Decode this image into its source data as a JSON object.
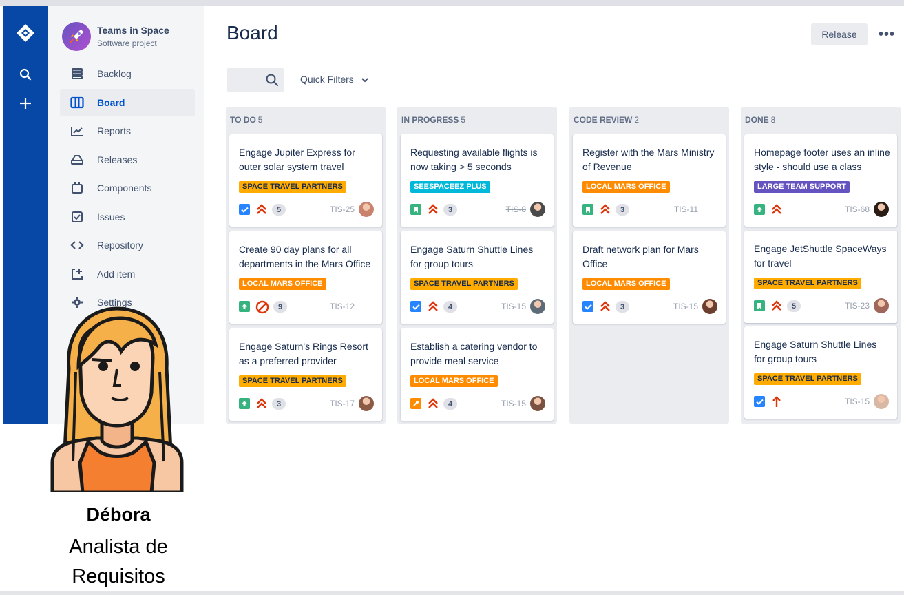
{
  "project": {
    "name": "Teams in Space",
    "type": "Software project"
  },
  "global_nav": {
    "icons": [
      "jira-logo-icon",
      "search-icon",
      "plus-icon"
    ]
  },
  "sidebar": {
    "items": [
      {
        "label": "Backlog",
        "icon": "backlog-icon",
        "active": false
      },
      {
        "label": "Board",
        "icon": "board-icon",
        "active": true
      },
      {
        "label": "Reports",
        "icon": "reports-icon",
        "active": false
      },
      {
        "label": "Releases",
        "icon": "releases-icon",
        "active": false
      },
      {
        "label": "Components",
        "icon": "components-icon",
        "active": false
      },
      {
        "label": "Issues",
        "icon": "issues-icon",
        "active": false
      },
      {
        "label": "Repository",
        "icon": "code-icon",
        "active": false
      },
      {
        "label": "Add item",
        "icon": "add-item-icon",
        "active": false
      },
      {
        "label": "Settings",
        "icon": "gear-icon",
        "active": false
      }
    ]
  },
  "header": {
    "title": "Board",
    "release_label": "Release",
    "more_label": "•••"
  },
  "filters": {
    "quick_filters_label": "Quick Filters"
  },
  "colors": {
    "nav_blue": "#0747a6",
    "yellow": "#ffab00",
    "orange": "#ff8b00",
    "teal": "#00b8d9",
    "purple": "#6554c0",
    "story_green": "#36b37e",
    "task_blue": "#2684ff",
    "priority_red": "#de350b"
  },
  "columns": [
    {
      "name": "TO DO",
      "count": "5",
      "cards": [
        {
          "title": "Engage Jupiter Express for outer solar system travel",
          "label": "SPACE TRAVEL PARTNERS",
          "label_color": "yellow",
          "type": "task",
          "priority": "highest",
          "points": "5",
          "key": "TIS-25",
          "key_done": false,
          "avatar": "#c9826b"
        },
        {
          "title": "Create 90 day plans for all departments in the Mars Office",
          "label": "LOCAL MARS OFFICE",
          "label_color": "orange",
          "type": "improvement",
          "priority": "blocker",
          "points": "9",
          "key": "TIS-12",
          "key_done": false,
          "avatar": ""
        },
        {
          "title": "Engage Saturn's Rings Resort as a preferred provider",
          "label": "SPACE TRAVEL PARTNERS",
          "label_color": "yellow",
          "type": "improvement",
          "priority": "highest",
          "points": "3",
          "key": "TIS-17",
          "key_done": false,
          "avatar": "#8a5a44"
        }
      ]
    },
    {
      "name": "IN PROGRESS",
      "count": "5",
      "cards": [
        {
          "title": "Requesting available flights is now taking > 5 seconds",
          "label": "SEESPACEEZ PLUS",
          "label_color": "teal",
          "type": "story",
          "priority": "highest",
          "points": "3",
          "key": "TIS-8",
          "key_done": true,
          "avatar": "#4a4a4a"
        },
        {
          "title": "Engage Saturn Shuttle Lines for group tours",
          "label": "SPACE TRAVEL PARTNERS",
          "label_color": "yellow",
          "type": "task",
          "priority": "highest",
          "points": "4",
          "key": "TIS-15",
          "key_done": false,
          "avatar": "#5d6b78"
        },
        {
          "title": "Establish a catering vendor to provide meal service",
          "label": "LOCAL MARS OFFICE",
          "label_color": "orange",
          "type": "improvement-orange",
          "priority": "highest",
          "points": "4",
          "key": "TIS-15",
          "key_done": false,
          "avatar": "#7a5040"
        }
      ]
    },
    {
      "name": "CODE REVIEW",
      "count": "2",
      "cards": [
        {
          "title": "Register with the Mars Ministry of Revenue",
          "label": "LOCAL MARS OFFICE",
          "label_color": "orange",
          "type": "story",
          "priority": "highest",
          "points": "3",
          "key": "TIS-11",
          "key_done": false,
          "avatar": ""
        },
        {
          "title": "Draft network plan for Mars Office",
          "label": "LOCAL MARS OFFICE",
          "label_color": "orange",
          "type": "task",
          "priority": "highest",
          "points": "3",
          "key": "TIS-15",
          "key_done": false,
          "avatar": "#6b3e2e"
        }
      ]
    },
    {
      "name": "DONE",
      "count": "8",
      "cards": [
        {
          "title": "Homepage footer uses an inline style - should use a class",
          "label": "LARGE TEAM SUPPORT",
          "label_color": "purple",
          "type": "improvement",
          "priority": "highest",
          "points": "",
          "key": "TIS-68",
          "key_done": false,
          "avatar": "#2b1d16"
        },
        {
          "title": "Engage JetShuttle SpaceWays for travel",
          "label": "SPACE TRAVEL PARTNERS",
          "label_color": "yellow",
          "type": "story",
          "priority": "highest",
          "points": "5",
          "key": "TIS-23",
          "key_done": false,
          "avatar": "#a0665a"
        },
        {
          "title": "Engage Saturn Shuttle Lines for group tours",
          "label": "SPACE TRAVEL PARTNERS",
          "label_color": "yellow",
          "type": "task",
          "priority": "high",
          "points": "",
          "key": "TIS-15",
          "key_done": false,
          "avatar": "#d8b7a4"
        }
      ]
    }
  ],
  "persona": {
    "name": "Débora",
    "role": "Analista de Requisitos"
  }
}
